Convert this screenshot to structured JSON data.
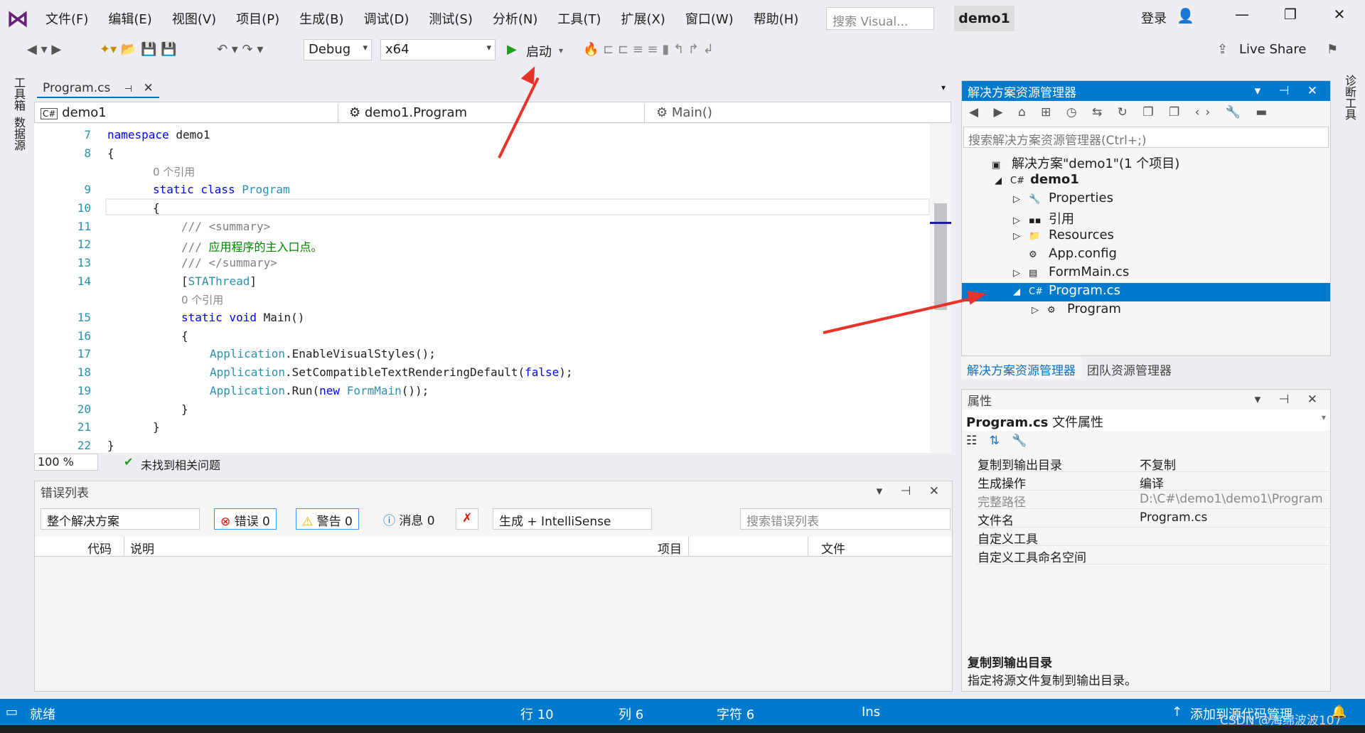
{
  "menu": [
    "文件(F)",
    "编辑(E)",
    "视图(V)",
    "项目(P)",
    "生成(B)",
    "调试(D)",
    "测试(S)",
    "分析(N)",
    "工具(T)",
    "扩展(X)",
    "窗口(W)",
    "帮助(H)"
  ],
  "search_placeholder": "搜索 Visual...",
  "window_title": "demo1",
  "login": "登录",
  "toolbar": {
    "config": "Debug",
    "platform": "x64",
    "start": "启动",
    "live_share": "Live Share"
  },
  "left_strip": [
    "工具箱",
    "数据源"
  ],
  "right_strip": "诊断工具",
  "editor": {
    "tab": "Program.cs",
    "nav_project": "demo1",
    "nav_class": "demo1.Program",
    "nav_member": "Main()",
    "lines": [
      {
        "n": "7",
        "html": "<span class='kw'>namespace</span> demo1",
        "indent": 0
      },
      {
        "n": "8",
        "html": "{",
        "indent": 0
      },
      {
        "n": "",
        "html": "<span class='ref'>0 个引用</span>",
        "indent": 1
      },
      {
        "n": "9",
        "html": "<span class='kw'>static class</span> <span class='ty'>Program</span>",
        "indent": 1
      },
      {
        "n": "10",
        "html": "{",
        "indent": 1
      },
      {
        "n": "11",
        "html": "<span class='gr'>/// &lt;summary&gt;</span>",
        "indent": 2
      },
      {
        "n": "12",
        "html": "<span class='gr'>///</span> <span class='cm'>应用程序的主入口点。</span>",
        "indent": 2
      },
      {
        "n": "13",
        "html": "<span class='gr'>/// &lt;/summary&gt;</span>",
        "indent": 2
      },
      {
        "n": "14",
        "html": "[<span class='ty'>STAThread</span>]",
        "indent": 2
      },
      {
        "n": "",
        "html": "<span class='ref'>0 个引用</span>",
        "indent": 2
      },
      {
        "n": "15",
        "html": "<span class='kw'>static void</span> Main()",
        "indent": 2
      },
      {
        "n": "16",
        "html": "{",
        "indent": 2
      },
      {
        "n": "17",
        "html": "<span class='ty'>Application</span>.EnableVisualStyles();",
        "indent": 3
      },
      {
        "n": "18",
        "html": "<span class='ty'>Application</span>.SetCompatibleTextRenderingDefault(<span class='kw'>false</span>);",
        "indent": 3
      },
      {
        "n": "19",
        "html": "<span class='ty'>Application</span>.Run(<span class='kw'>new</span> <span class='ty'>FormMain</span>());",
        "indent": 3
      },
      {
        "n": "20",
        "html": "}",
        "indent": 2
      },
      {
        "n": "21",
        "html": "}",
        "indent": 1
      },
      {
        "n": "22",
        "html": "}",
        "indent": 0
      }
    ],
    "zoom": "100 %",
    "issues": "未找到相关问题"
  },
  "error_list": {
    "title": "错误列表",
    "scope": "整个解决方案",
    "errors": "错误 0",
    "warnings": "警告 0",
    "messages": "消息 0",
    "source": "生成 + IntelliSense",
    "search_placeholder": "搜索错误列表",
    "columns": [
      "代码",
      "说明",
      "项目",
      "文件"
    ]
  },
  "solution_explorer": {
    "title": "解决方案资源管理器",
    "search_placeholder": "搜索解决方案资源管理器(Ctrl+;)",
    "items": [
      {
        "label": "解决方案\"demo1\"(1 个项目)",
        "level": 0,
        "exp": "",
        "icon": "▣"
      },
      {
        "label": "demo1",
        "level": 1,
        "exp": "◢",
        "icon": "C#",
        "bold": true
      },
      {
        "label": "Properties",
        "level": 2,
        "exp": "▷",
        "icon": "🔧"
      },
      {
        "label": "引用",
        "level": 2,
        "exp": "▷",
        "icon": "▪▪"
      },
      {
        "label": "Resources",
        "level": 2,
        "exp": "▷",
        "icon": "📁"
      },
      {
        "label": "App.config",
        "level": 2,
        "exp": "",
        "icon": "⚙"
      },
      {
        "label": "FormMain.cs",
        "level": 2,
        "exp": "▷",
        "icon": "▤"
      },
      {
        "label": "Program.cs",
        "level": 2,
        "exp": "◢",
        "icon": "C#",
        "selected": true
      },
      {
        "label": "Program",
        "level": 3,
        "exp": "▷",
        "icon": "⚙"
      }
    ],
    "tabs": [
      "解决方案资源管理器",
      "团队资源管理器"
    ]
  },
  "properties": {
    "title": "属性",
    "object": "Program.cs",
    "object_type": "文件属性",
    "rows": [
      {
        "k": "复制到输出目录",
        "v": "不复制"
      },
      {
        "k": "生成操作",
        "v": "编译"
      },
      {
        "k": "完整路径",
        "v": "D:\\C#\\demo1\\demo1\\Program",
        "dim": true
      },
      {
        "k": "文件名",
        "v": "Program.cs"
      },
      {
        "k": "自定义工具",
        "v": ""
      },
      {
        "k": "自定义工具命名空间",
        "v": ""
      }
    ],
    "desc_title": "复制到输出目录",
    "desc_text": "指定将源文件复制到输出目录。"
  },
  "status": {
    "ready": "就绪",
    "line": "行 10",
    "col": "列 6",
    "char": "字符 6",
    "ins": "Ins",
    "source_control": "添加到源代码管理",
    "watermark": "CSDN @海绵波波107"
  },
  "colors": {
    "accent": "#007acc",
    "arrow": "#e8332a"
  }
}
